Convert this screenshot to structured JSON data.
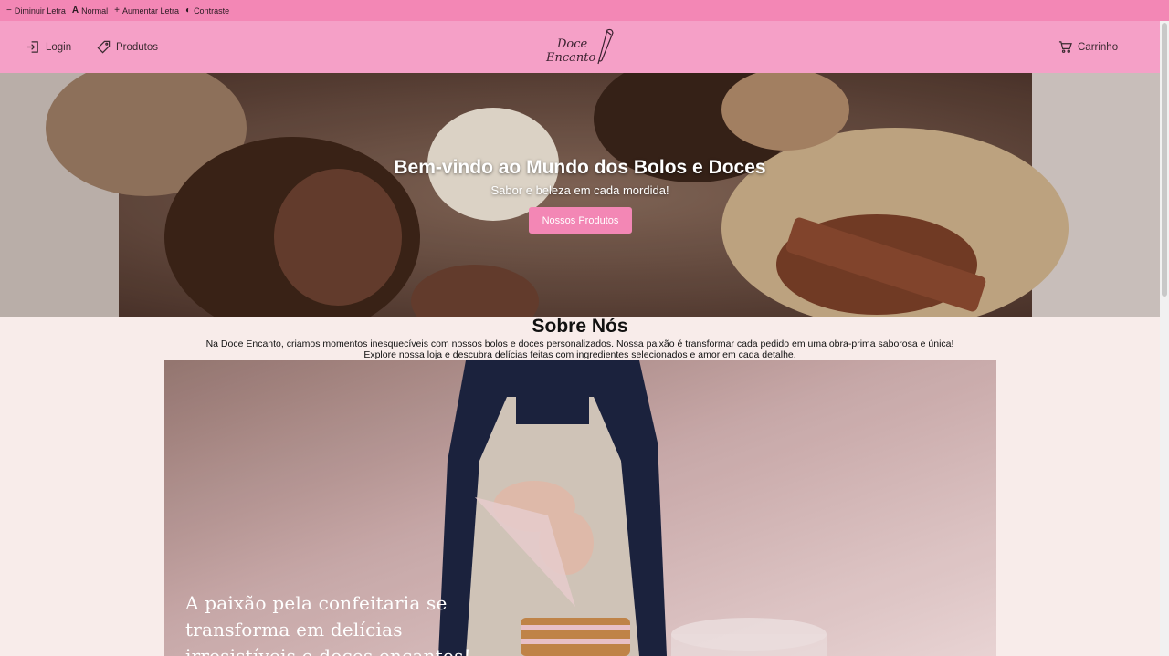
{
  "accessibility_bar": {
    "decrease_label": "Diminuir Letra",
    "normal_label": "Normal",
    "increase_label": "Aumentar Letra",
    "contrast_label": "Contraste",
    "decrease_icon": "minus-icon",
    "normal_icon": "font-icon",
    "increase_icon": "plus-icon",
    "contrast_icon": "contrast-icon"
  },
  "header": {
    "login_label": "Login",
    "products_label": "Produtos",
    "cart_label": "Carrinho",
    "logo_line1": "Doce",
    "logo_line2": "Encanto"
  },
  "hero": {
    "title": "Bem-vindo ao Mundo dos Bolos e Doces",
    "subtitle": "Sabor e beleza em cada mordida!",
    "button_label": "Nossos Produtos"
  },
  "about": {
    "title": "Sobre Nós",
    "paragraph_line1": "Na Doce Encanto, criamos momentos inesquecíveis com nossos bolos e doces personalizados. Nossa paixão é transformar cada pedido em uma obra-prima saborosa e única!",
    "paragraph_line2": "Explore nossa loja e descubra delícias feitas com ingredientes selecionados e amor em cada detalhe.",
    "image_caption": "A paixão pela confeitaria se transforma em delícias irresistíveis e doces encantos!"
  },
  "colors": {
    "accessibility_bar": "#f387b5",
    "header": "#f5a0c7",
    "button": "#f387b5",
    "page_background": "#f8ecea"
  }
}
